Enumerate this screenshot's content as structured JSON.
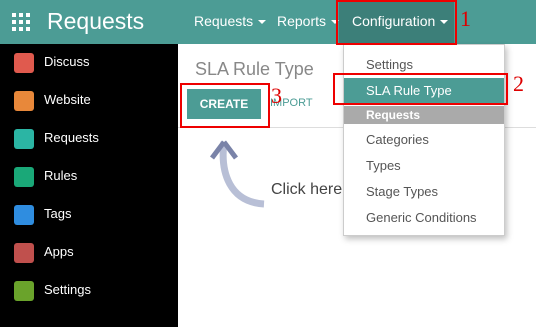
{
  "app": {
    "title": "Requests"
  },
  "topnav": [
    {
      "label": "Requests"
    },
    {
      "label": "Reports"
    },
    {
      "label": "Configuration"
    }
  ],
  "sidebar": {
    "items": [
      {
        "label": "Discuss",
        "icon": "discuss-icon",
        "color": "#e05a4e"
      },
      {
        "label": "Website",
        "icon": "website-icon",
        "color": "#e8883a"
      },
      {
        "label": "Requests",
        "icon": "megaphone-icon",
        "color": "#2bb5a4"
      },
      {
        "label": "Rules",
        "icon": "rules-icon",
        "color": "#1aa878"
      },
      {
        "label": "Tags",
        "icon": "tags-icon",
        "color": "#2f8de0"
      },
      {
        "label": "Apps",
        "icon": "apps-icon",
        "color": "#c0504d"
      },
      {
        "label": "Settings",
        "icon": "gear-icon",
        "color": "#6aa32b"
      }
    ]
  },
  "main": {
    "title": "SLA Rule Type",
    "create_label": "CREATE",
    "import_label": "IMPORT",
    "click_here": "Click here"
  },
  "dropdown": {
    "items": [
      {
        "label": "Settings"
      },
      {
        "label": "SLA Rule Type"
      },
      {
        "label": "Requests"
      },
      {
        "label": "Categories"
      },
      {
        "label": "Types"
      },
      {
        "label": "Stage Types"
      },
      {
        "label": "Generic Conditions"
      }
    ]
  },
  "annotations": {
    "one": "1",
    "two": "2",
    "three": "3"
  },
  "colors": {
    "primary": "#4c9c95",
    "annotation": "#e00000"
  }
}
